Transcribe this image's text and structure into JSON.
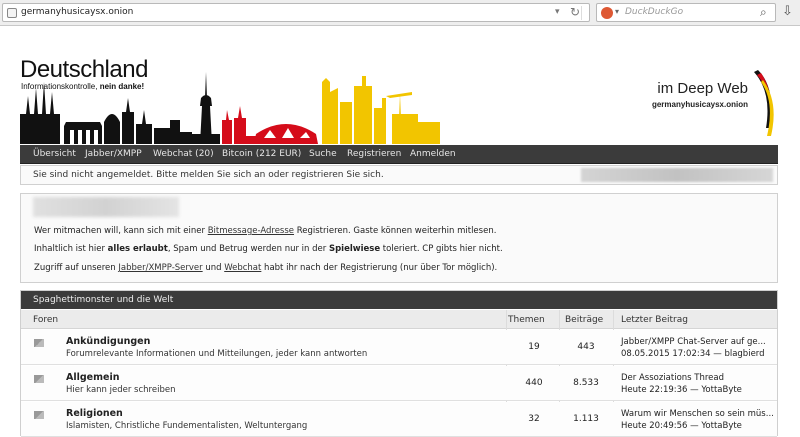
{
  "browser": {
    "url": "germanyhusicaysx.onion",
    "search_placeholder": "DuckDuckGo"
  },
  "site": {
    "title": "Deutschland",
    "subtitle_plain": "Informationskontrolle, ",
    "subtitle_bold": "nein danke!",
    "tagline": "im Deep Web",
    "onion_address": "germanyhusicaysx.onion"
  },
  "nav": {
    "items": [
      "Übersicht",
      "Jabber/XMPP",
      "Webchat (20)",
      "Bitcoin (212 EUR)",
      "Suche",
      "Registrieren",
      "Anmelden"
    ]
  },
  "notice": {
    "message": "Sie sind nicht angemeldet. Bitte melden Sie sich an oder registrieren Sie sich."
  },
  "info": {
    "line1_pre": "Wer mitmachen will, kann sich mit einer ",
    "line1_link": "Bitmessage-Adresse",
    "line1_post": " Registrieren. Gaste können weiterhin mitlesen.",
    "line2_pre": "Inhaltlich ist hier ",
    "line2_bold1": "alles erlaubt",
    "line2_mid": ", Spam und Betrug werden nur in der ",
    "line2_bold2": "Spielwiese",
    "line2_post": " toleriert. CP gibts hier nicht.",
    "line3_pre": "Zugriff auf unseren ",
    "line3_link1": "Jabber/XMPP-Server",
    "line3_mid": " und ",
    "line3_link2": "Webchat",
    "line3_post": " habt ihr nach der Registrierung (nur über Tor möglich)."
  },
  "forum": {
    "category": "Spaghettimonster und die Welt",
    "columns": {
      "forum": "Foren",
      "topics": "Themen",
      "posts": "Beiträge",
      "last_post": "Letzter Beitrag"
    },
    "rows": [
      {
        "name": "Ankündigungen",
        "description": "Forumrelevante Informationen und Mitteilungen, jeder kann antworten",
        "topics": "19",
        "posts": "443",
        "last_title": "Jabber/XMPP Chat-Server auf ge...",
        "last_meta": "08.05.2015 17:02:34 — blagbierd"
      },
      {
        "name": "Allgemein",
        "description": "Hier kann jeder schreiben",
        "topics": "440",
        "posts": "8.533",
        "last_title": "Der Assoziations Thread",
        "last_meta": "Heute 22:19:36 — YottaByte"
      },
      {
        "name": "Religionen",
        "description": "Islamisten, Christliche Fundementalisten, Weltuntergang",
        "topics": "32",
        "posts": "1.113",
        "last_title": "Warum wir Menschen so sein müs...",
        "last_meta": "Heute 20:49:56 — YottaByte"
      }
    ]
  },
  "colors": {
    "skyline_black": "#111111",
    "skyline_red": "#d50c1a",
    "skyline_gold": "#f2c500",
    "nav_bg": "#3b3b3b"
  }
}
